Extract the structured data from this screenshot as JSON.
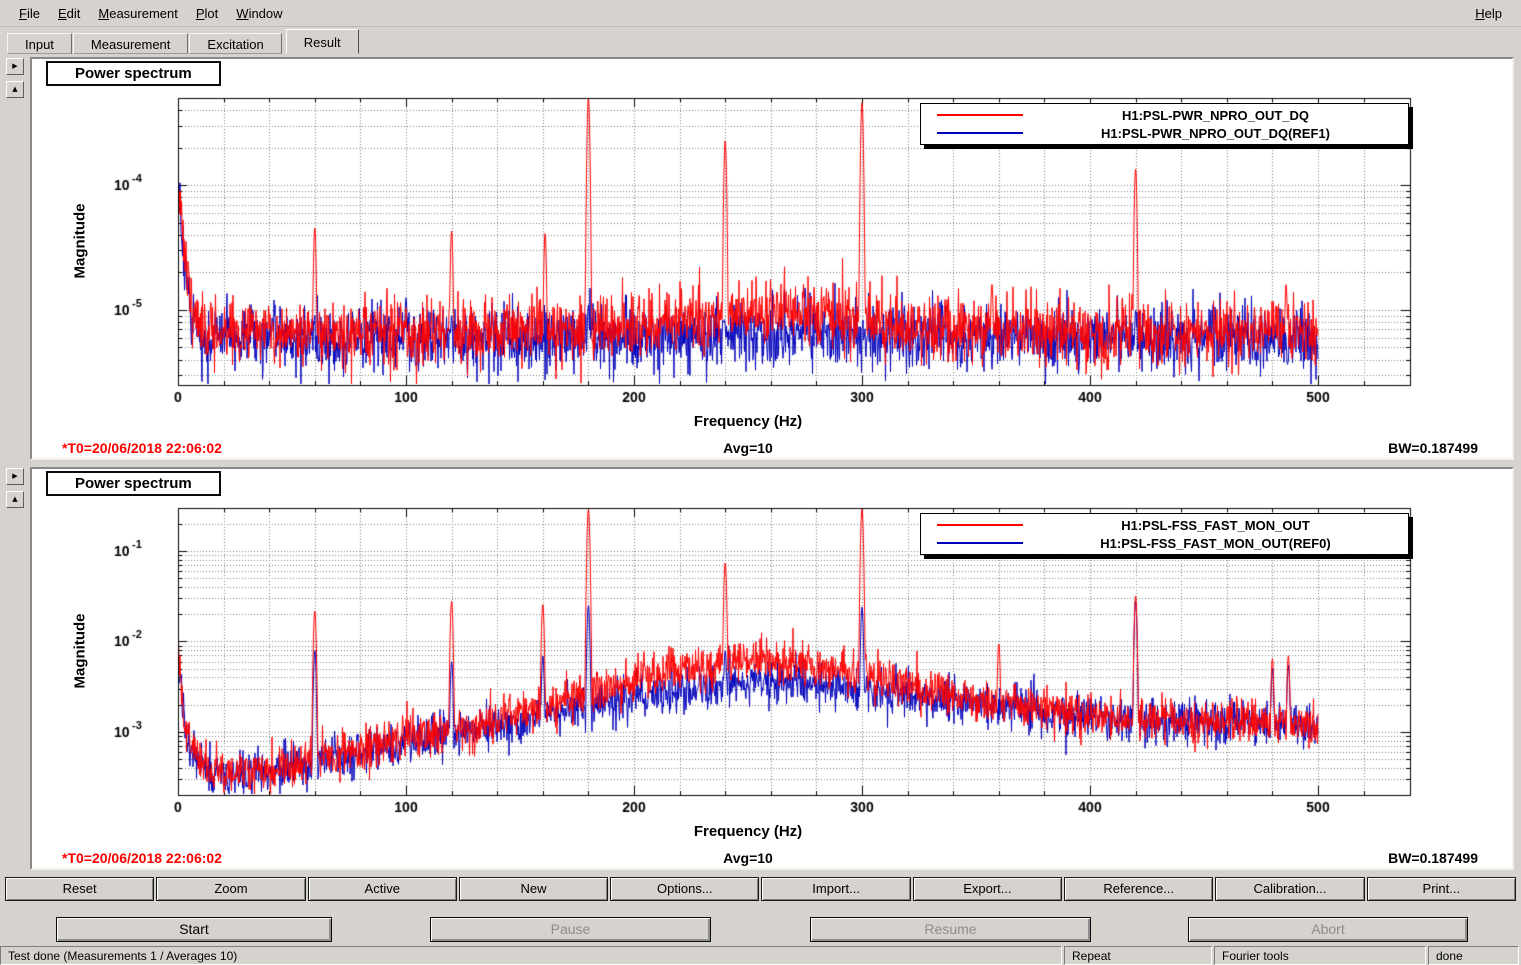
{
  "menu": {
    "items": [
      {
        "label": "File"
      },
      {
        "label": "Edit"
      },
      {
        "label": "Measurement"
      },
      {
        "label": "Plot"
      },
      {
        "label": "Window"
      }
    ],
    "help_label": "Help"
  },
  "tabs": [
    {
      "label": "Input",
      "active": false
    },
    {
      "label": "Measurement",
      "active": false
    },
    {
      "label": "Excitation",
      "active": false
    },
    {
      "label": "Result",
      "active": true
    }
  ],
  "pane_controls": {
    "expand_icon": "▶",
    "collapse_icon": "▲"
  },
  "chart_data": [
    {
      "id": "power-spectrum-top",
      "type": "line",
      "title": "Power spectrum",
      "xlabel": "Frequency (Hz)",
      "ylabel": "Magnitude",
      "xlim": [
        0,
        540
      ],
      "data_xmax": 500,
      "xticks": [
        0,
        100,
        200,
        300,
        400,
        500
      ],
      "x_minor_step": 20,
      "ylog": true,
      "ylim": [
        2.5e-06,
        0.0005
      ],
      "ytick_decades": [
        -4,
        -5
      ],
      "grid": "dotted",
      "legend_position": "top-right",
      "annotations": {
        "t0": "*T0=20/06/2018 22:06:02",
        "avg": "Avg=10",
        "bw": "BW=0.187499"
      },
      "series": [
        {
          "name": "H1:PSL-PWR_NPRO_OUT_DQ",
          "color": "#ff0000",
          "seed": 11,
          "noise_sigma_decades": 0.13,
          "baseline_hz_mag": [
            [
              0,
              0.00015
            ],
            [
              1,
              8e-05
            ],
            [
              3,
              2.5e-05
            ],
            [
              6,
              1.1e-05
            ],
            [
              12,
              7e-06
            ],
            [
              25,
              6.6e-06
            ],
            [
              100,
              6.5e-06
            ],
            [
              150,
              6.7e-06
            ],
            [
              190,
              7.3e-06
            ],
            [
              220,
              8.6e-06
            ],
            [
              250,
              9.6e-06
            ],
            [
              275,
              9.6e-06
            ],
            [
              295,
              8.6e-06
            ],
            [
              315,
              7.4e-06
            ],
            [
              345,
              6.8e-06
            ],
            [
              420,
              6.6e-06
            ],
            [
              500,
              6.6e-06
            ]
          ],
          "peaks_hz_mag": [
            [
              60,
              4.6e-05
            ],
            [
              120,
              4.3e-05
            ],
            [
              161,
              4.1e-05
            ],
            [
              180,
              0.0005
            ],
            [
              240,
              0.00023
            ],
            [
              300,
              0.00046
            ],
            [
              357,
              1.6e-05
            ],
            [
              420,
              0.000135
            ],
            [
              486,
              1.6e-05
            ]
          ]
        },
        {
          "name": "H1:PSL-PWR_NPRO_OUT_DQ(REF1)",
          "color": "#0000bb",
          "seed": 22,
          "noise_sigma_decades": 0.13,
          "baseline_hz_mag": [
            [
              0,
              0.0001
            ],
            [
              1,
              6e-05
            ],
            [
              3,
              2e-05
            ],
            [
              6,
              9e-06
            ],
            [
              12,
              6.2e-06
            ],
            [
              25,
              5.9e-06
            ],
            [
              200,
              5.9e-06
            ],
            [
              250,
              6.3e-06
            ],
            [
              272,
              6.6e-06
            ],
            [
              300,
              6.2e-06
            ],
            [
              340,
              5.9e-06
            ],
            [
              500,
              5.9e-06
            ]
          ],
          "peaks_hz_mag": [
            [
              100,
              1.25e-05
            ],
            [
              120,
              9e-06
            ],
            [
              180,
              1.1e-05
            ],
            [
              275,
              1.5e-05
            ],
            [
              420,
              1e-05
            ]
          ]
        }
      ]
    },
    {
      "id": "power-spectrum-bottom",
      "type": "line",
      "title": "Power spectrum",
      "xlabel": "Frequency (Hz)",
      "ylabel": "Magnitude",
      "xlim": [
        0,
        540
      ],
      "data_xmax": 500,
      "xticks": [
        0,
        100,
        200,
        300,
        400,
        500
      ],
      "x_minor_step": 20,
      "ylog": true,
      "ylim": [
        0.0002,
        0.3
      ],
      "ytick_decades": [
        -1,
        -2,
        -3
      ],
      "grid": "dotted",
      "legend_position": "top-right",
      "annotations": {
        "t0": "*T0=20/06/2018 22:06:02",
        "avg": "Avg=10",
        "bw": "BW=0.187499"
      },
      "series": [
        {
          "name": "H1:PSL-FSS_FAST_MON_OUT",
          "color": "#ff0000",
          "seed": 33,
          "noise_sigma_decades": 0.12,
          "baseline_hz_mag": [
            [
              0,
              0.008
            ],
            [
              1,
              0.004
            ],
            [
              3,
              0.0012
            ],
            [
              6,
              0.0006
            ],
            [
              10,
              0.00042
            ],
            [
              15,
              0.00036
            ],
            [
              25,
              0.00034
            ],
            [
              40,
              0.00038
            ],
            [
              60,
              0.00048
            ],
            [
              80,
              0.00063
            ],
            [
              100,
              0.00085
            ],
            [
              120,
              0.00105
            ],
            [
              140,
              0.0014
            ],
            [
              160,
              0.0019
            ],
            [
              180,
              0.0026
            ],
            [
              200,
              0.0036
            ],
            [
              220,
              0.0048
            ],
            [
              240,
              0.0058
            ],
            [
              255,
              0.0062
            ],
            [
              270,
              0.0058
            ],
            [
              285,
              0.0052
            ],
            [
              300,
              0.0044
            ],
            [
              315,
              0.0034
            ],
            [
              330,
              0.0028
            ],
            [
              350,
              0.0022
            ],
            [
              370,
              0.00185
            ],
            [
              390,
              0.0016
            ],
            [
              410,
              0.00145
            ],
            [
              430,
              0.00135
            ],
            [
              455,
              0.0013
            ],
            [
              480,
              0.00128
            ],
            [
              500,
              0.00115
            ]
          ],
          "peaks_hz_mag": [
            [
              60,
              0.022
            ],
            [
              120,
              0.028
            ],
            [
              160,
              0.026
            ],
            [
              180,
              0.29
            ],
            [
              240,
              0.075
            ],
            [
              300,
              0.29
            ],
            [
              360,
              0.0095
            ],
            [
              420,
              0.032
            ],
            [
              480,
              0.0065
            ],
            [
              487,
              0.007
            ]
          ]
        },
        {
          "name": "H1:PSL-FSS_FAST_MON_OUT(REF0)",
          "color": "#0000bb",
          "seed": 44,
          "noise_sigma_decades": 0.12,
          "baseline_hz_mag": [
            [
              0,
              0.007
            ],
            [
              1,
              0.0035
            ],
            [
              3,
              0.0011
            ],
            [
              6,
              0.00055
            ],
            [
              10,
              0.0004
            ],
            [
              15,
              0.00035
            ],
            [
              25,
              0.00033
            ],
            [
              40,
              0.00037
            ],
            [
              60,
              0.00045
            ],
            [
              80,
              0.00059
            ],
            [
              100,
              0.00076
            ],
            [
              120,
              0.00094
            ],
            [
              140,
              0.0012
            ],
            [
              160,
              0.0015
            ],
            [
              180,
              0.0019
            ],
            [
              200,
              0.0024
            ],
            [
              220,
              0.0029
            ],
            [
              240,
              0.0033
            ],
            [
              255,
              0.0035
            ],
            [
              270,
              0.0034
            ],
            [
              285,
              0.0032
            ],
            [
              300,
              0.00295
            ],
            [
              315,
              0.00265
            ],
            [
              330,
              0.0024
            ],
            [
              350,
              0.0021
            ],
            [
              370,
              0.0018
            ],
            [
              390,
              0.00155
            ],
            [
              410,
              0.0014
            ],
            [
              430,
              0.00132
            ],
            [
              455,
              0.00128
            ],
            [
              480,
              0.00125
            ],
            [
              500,
              0.0011
            ]
          ],
          "peaks_hz_mag": [
            [
              60,
              0.008
            ],
            [
              120,
              0.006
            ],
            [
              160,
              0.007
            ],
            [
              180,
              0.025
            ],
            [
              240,
              0.008
            ],
            [
              300,
              0.024
            ],
            [
              420,
              0.028
            ],
            [
              480,
              0.005
            ],
            [
              487,
              0.0055
            ]
          ]
        }
      ]
    }
  ],
  "toolbar": {
    "buttons": [
      "Reset",
      "Zoom",
      "Active",
      "New",
      "Options...",
      "Import...",
      "Export...",
      "Reference...",
      "Calibration...",
      "Print..."
    ]
  },
  "controls": [
    {
      "label": "Start",
      "enabled": true
    },
    {
      "label": "Pause",
      "enabled": false
    },
    {
      "label": "Resume",
      "enabled": false
    },
    {
      "label": "Abort",
      "enabled": false
    }
  ],
  "statusbar": {
    "message": "Test done (Measurements 1 / Averages 10)",
    "repeat": "Repeat",
    "tool": "Fourier tools",
    "state": "done"
  },
  "colors": {
    "trace1": "#ff0000",
    "trace2": "#0000bb",
    "chrome": "#d6d3ce",
    "annotation_red": "#ff0000"
  }
}
